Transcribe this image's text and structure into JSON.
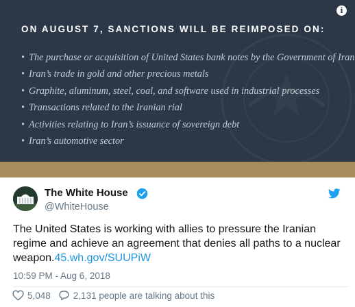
{
  "banner": {
    "heading": "ON AUGUST 7, SANCTIONS WILL BE REIMPOSED ON:",
    "items": [
      "The purchase or acquisition of United States bank notes by the Government of Iran",
      "Iran’s trade in gold and other precious metals",
      "Graphite, aluminum, steel, coal, and software used in industrial processes",
      "Transactions related to the Iranian rial",
      "Activities relating to Iran’s issuance of sovereign debt",
      "Iran’s automotive sector"
    ],
    "info_icon": "info-icon",
    "colors": {
      "background": "#2c3847",
      "accent_bar": "#a58e5b"
    }
  },
  "tweet": {
    "author_name": "The White House",
    "handle": "@WhiteHouse",
    "verified_icon": "verified-badge-icon",
    "platform_icon": "twitter-bird-icon",
    "text": "The United States is working with allies to pressure the Iranian regime and achieve an agreement that denies all paths to a nuclear weapon.",
    "link_text": "45.wh.gov/SUUPiW",
    "timestamp": "10:59 PM - Aug 6, 2018",
    "likes": "5,048",
    "replies_text": "2,131 people are talking about this",
    "colors": {
      "link": "#1b95e0",
      "verified": "#1da1f2"
    }
  }
}
